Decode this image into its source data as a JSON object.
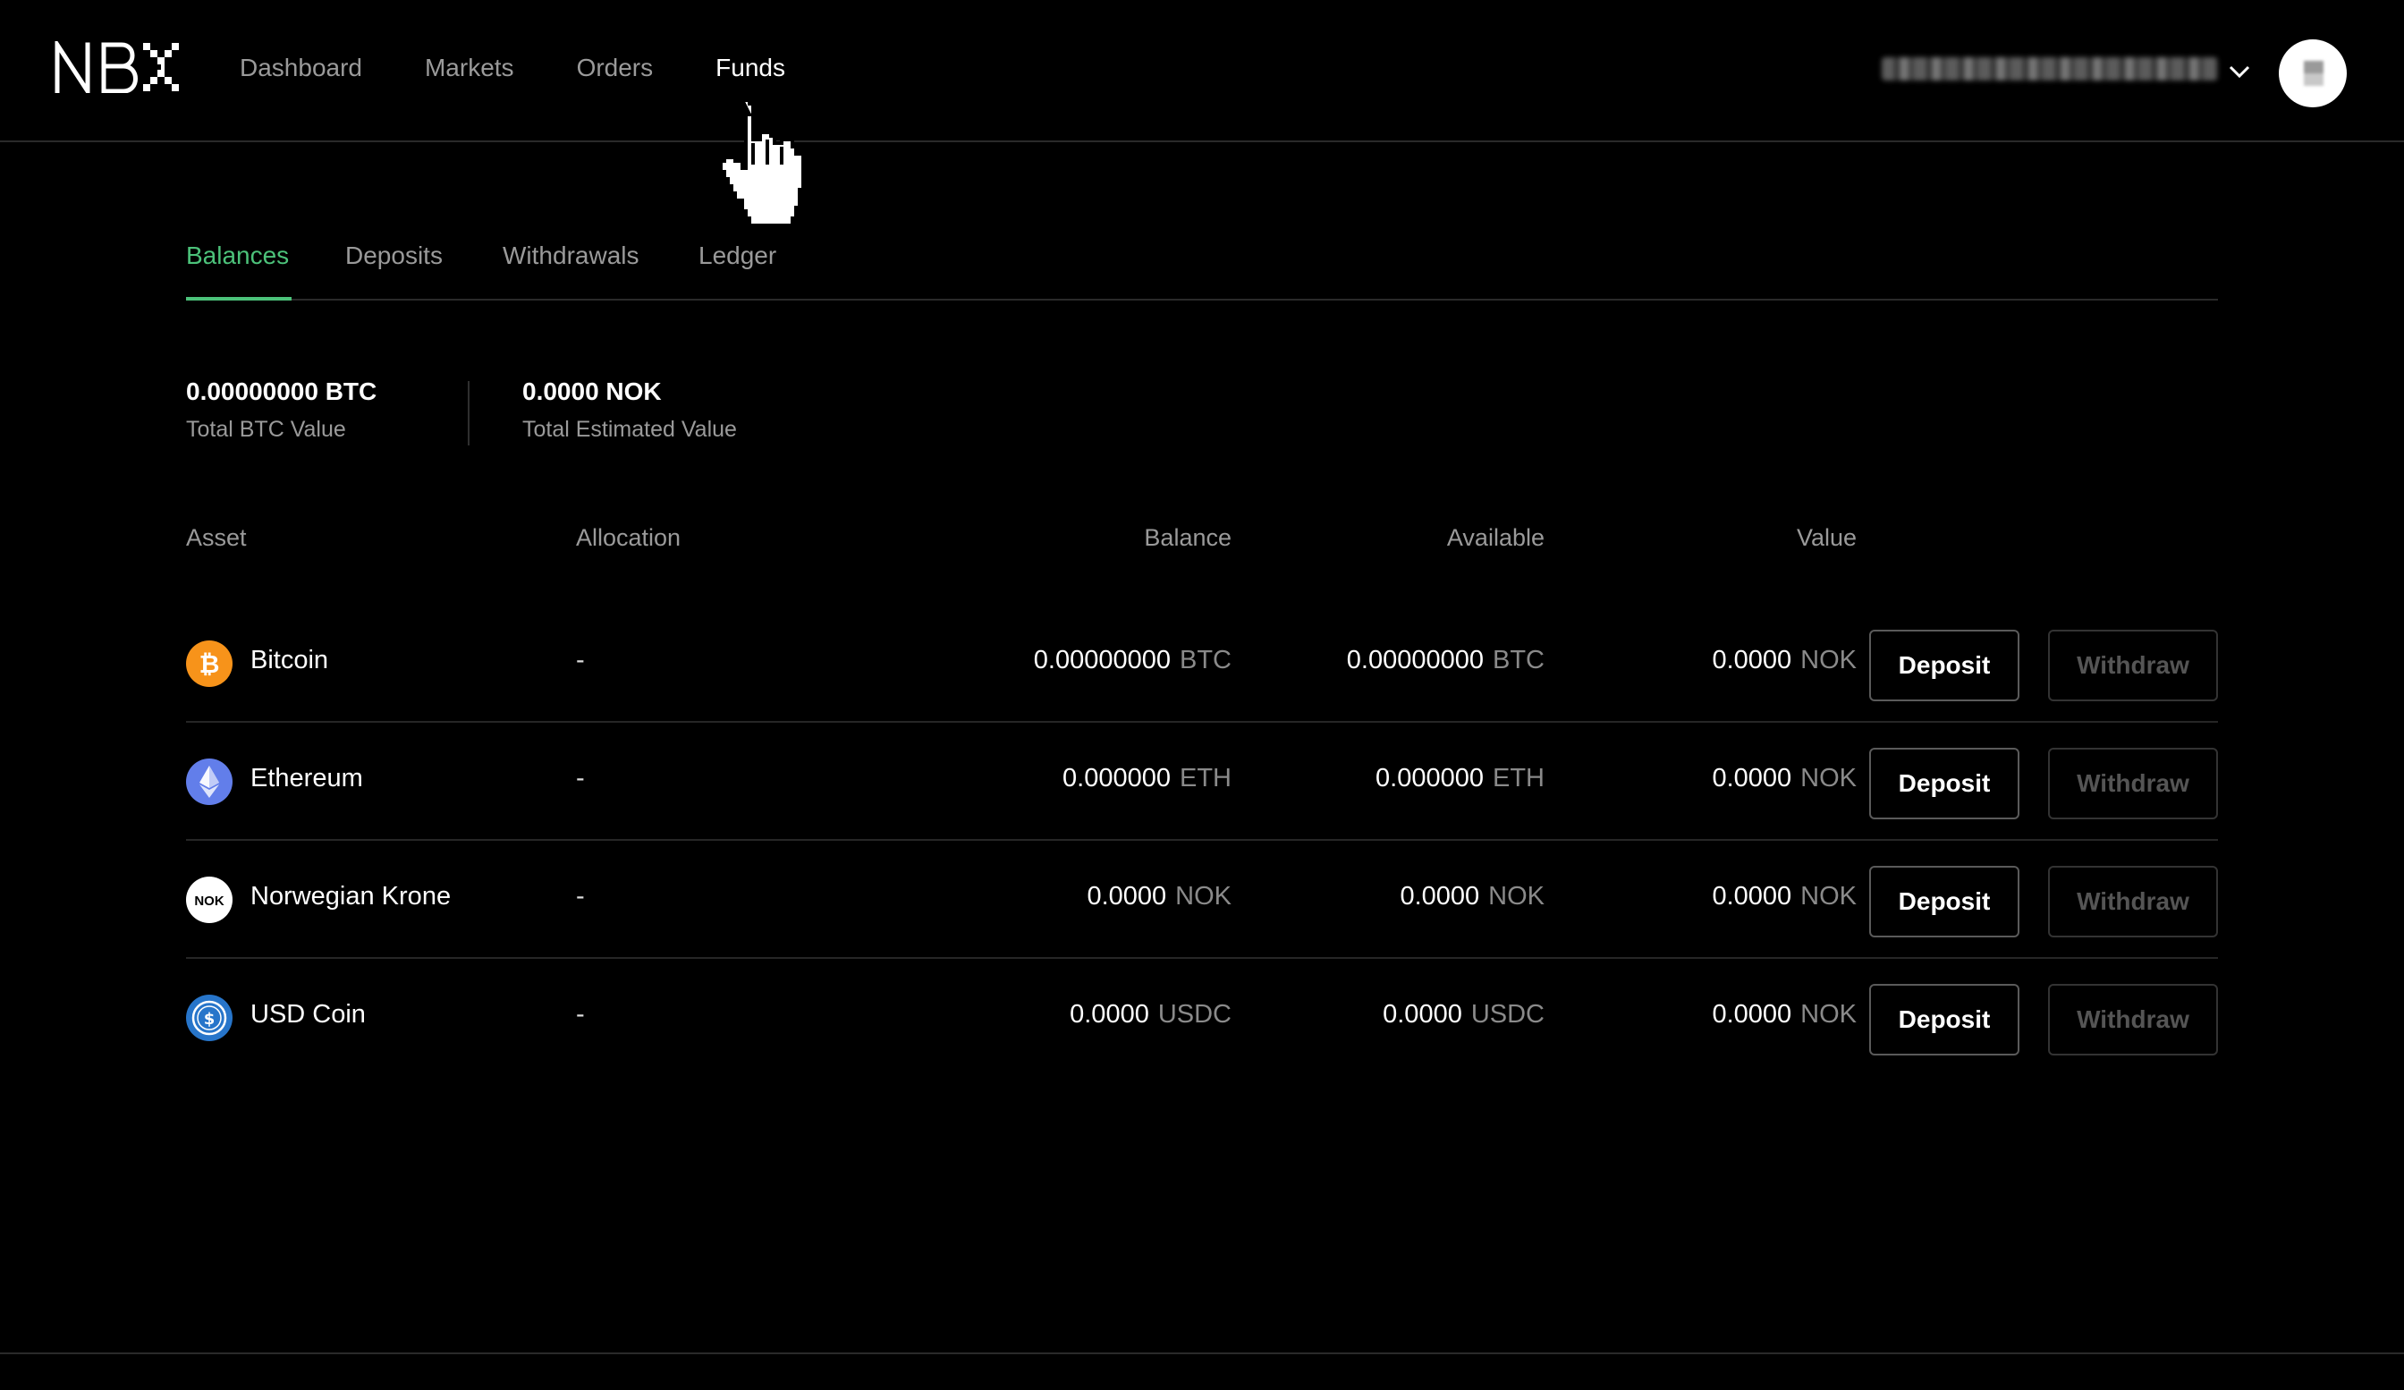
{
  "header": {
    "logo_text": "NBX",
    "nav": [
      {
        "label": "Dashboard",
        "active": false
      },
      {
        "label": "Markets",
        "active": false
      },
      {
        "label": "Orders",
        "active": false
      },
      {
        "label": "Funds",
        "active": true
      }
    ],
    "account_menu_icon": "chevron-down-icon",
    "avatar_icon": "avatar"
  },
  "tabs": [
    {
      "label": "Balances",
      "active": true
    },
    {
      "label": "Deposits",
      "active": false
    },
    {
      "label": "Withdrawals",
      "active": false
    },
    {
      "label": "Ledger",
      "active": false
    }
  ],
  "summary": {
    "btc": {
      "value": "0.00000000 BTC",
      "label": "Total BTC Value"
    },
    "nok": {
      "value": "0.0000 NOK",
      "label": "Total Estimated Value"
    }
  },
  "table": {
    "headers": {
      "asset": "Asset",
      "allocation": "Allocation",
      "balance": "Balance",
      "available": "Available",
      "value": "Value"
    },
    "rows": [
      {
        "name": "Bitcoin",
        "icon": "bitcoin-icon",
        "allocation": "-",
        "balance": "0.00000000",
        "balance_unit": "BTC",
        "available": "0.00000000",
        "available_unit": "BTC",
        "value": "0.0000",
        "value_unit": "NOK",
        "deposit_label": "Deposit",
        "withdraw_label": "Withdraw"
      },
      {
        "name": "Ethereum",
        "icon": "ethereum-icon",
        "allocation": "-",
        "balance": "0.000000",
        "balance_unit": "ETH",
        "available": "0.000000",
        "available_unit": "ETH",
        "value": "0.0000",
        "value_unit": "NOK",
        "deposit_label": "Deposit",
        "withdraw_label": "Withdraw"
      },
      {
        "name": "Norwegian Krone",
        "icon": "nok-icon",
        "icon_text": "NOK",
        "allocation": "-",
        "balance": "0.0000",
        "balance_unit": "NOK",
        "available": "0.0000",
        "available_unit": "NOK",
        "value": "0.0000",
        "value_unit": "NOK",
        "deposit_label": "Deposit",
        "withdraw_label": "Withdraw"
      },
      {
        "name": "USD Coin",
        "icon": "usdc-icon",
        "allocation": "-",
        "balance": "0.0000",
        "balance_unit": "USDC",
        "available": "0.0000",
        "available_unit": "USDC",
        "value": "0.0000",
        "value_unit": "NOK",
        "deposit_label": "Deposit",
        "withdraw_label": "Withdraw"
      }
    ]
  },
  "colors": {
    "accent_green": "#4cc27a",
    "bitcoin_orange": "#f7931a",
    "ethereum_purple": "#627eea",
    "usdc_blue": "#2775ca",
    "background": "#000000"
  }
}
